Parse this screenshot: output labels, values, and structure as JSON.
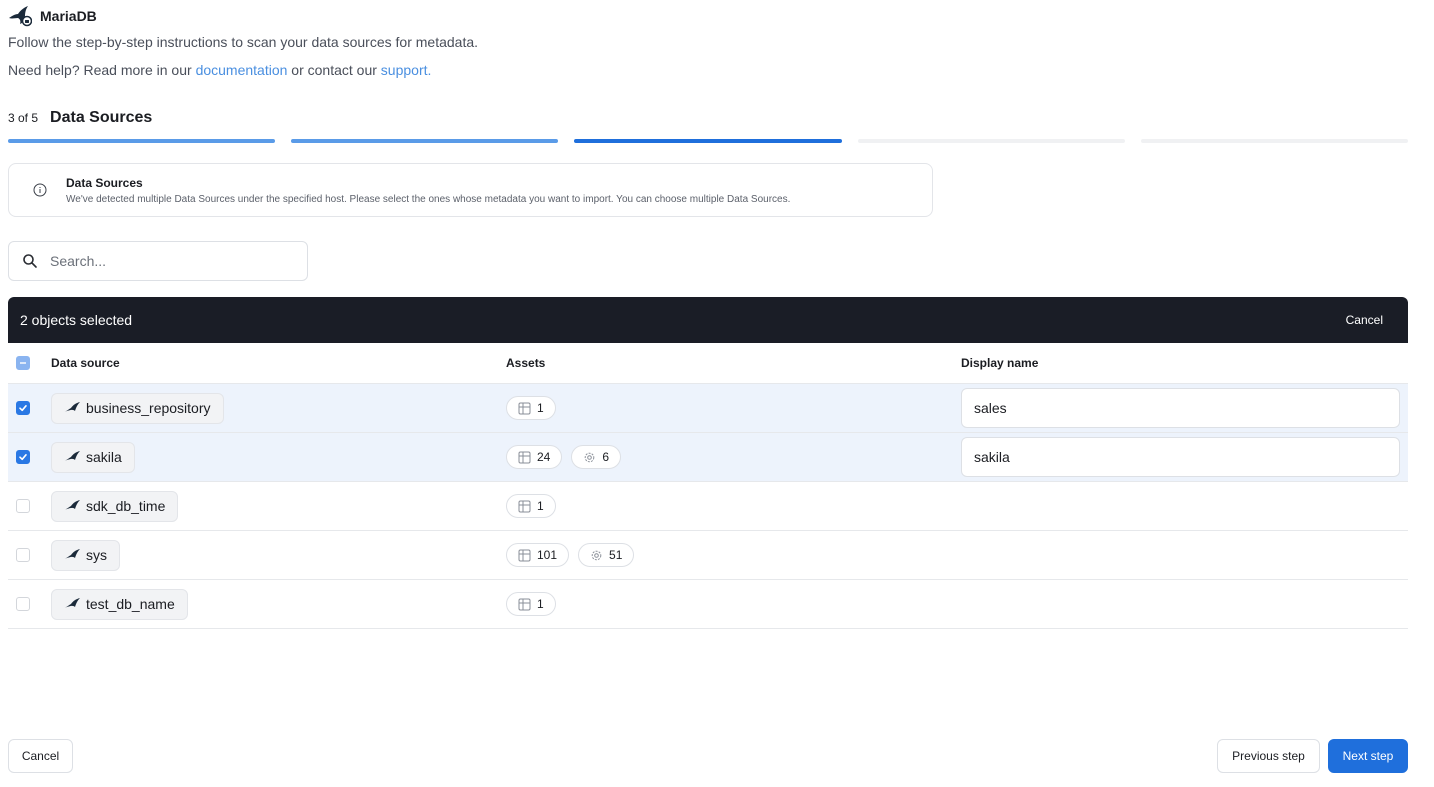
{
  "header": {
    "title": "MariaDB",
    "icon": "mariadb-seal-icon"
  },
  "intro": "Follow the step-by-step instructions to scan your data sources for metadata.",
  "help": {
    "prefix": "Need help? Read more in our",
    "doc_link": "documentation",
    "middle": "or contact our",
    "support_link": "support."
  },
  "stepper": {
    "counter": "3 of 5",
    "title": "Data Sources",
    "total_steps": 5,
    "current_step": 3
  },
  "info": {
    "icon": "info-icon",
    "title": "Data Sources",
    "description": "We've detected multiple Data Sources under the specified host. Please select the ones whose metadata you want to import. You can choose multiple Data Sources."
  },
  "search": {
    "placeholder": "Search...",
    "value": "",
    "icon": "search-icon"
  },
  "selection_bar": {
    "count_label": "2 objects selected",
    "cancel_label": "Cancel"
  },
  "table": {
    "headers": {
      "source": "Data source",
      "assets": "Assets",
      "display_name": "Display name"
    },
    "rows": [
      {
        "name": "business_repository",
        "selected": true,
        "tables": "1",
        "procs": null,
        "display_name": "sales"
      },
      {
        "name": "sakila",
        "selected": true,
        "tables": "24",
        "procs": "6",
        "display_name": "sakila"
      },
      {
        "name": "sdk_db_time",
        "selected": false,
        "tables": "1",
        "procs": null,
        "display_name": null
      },
      {
        "name": "sys",
        "selected": false,
        "tables": "101",
        "procs": "51",
        "display_name": null
      },
      {
        "name": "test_db_name",
        "selected": false,
        "tables": "1",
        "procs": null,
        "display_name": null
      }
    ]
  },
  "footer": {
    "cancel": "Cancel",
    "previous": "Previous step",
    "next": "Next step"
  },
  "colors": {
    "accent": "#1f6fdc",
    "dark_bar": "#1a1d26",
    "selected_row": "#edf3fc",
    "link": "#4a8fe0"
  }
}
